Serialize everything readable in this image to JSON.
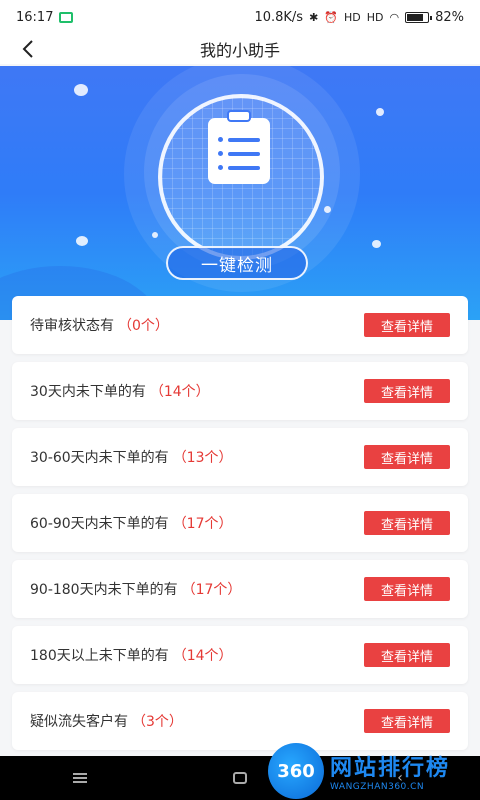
{
  "status_bar": {
    "time": "16:17",
    "network_speed": "10.8K/s",
    "signal_1": "HD",
    "signal_2": "HD",
    "battery": "82%",
    "battery_level": 0.82
  },
  "nav": {
    "title": "我的小助手",
    "back_icon": "chevron-left-icon"
  },
  "hero": {
    "icon": "clipboard-icon",
    "detect_button": "一键检测"
  },
  "items": [
    {
      "label": "待审核状态有",
      "count": "（0个）",
      "button": "查看详情"
    },
    {
      "label": "30天内未下单的有",
      "count": "（14个）",
      "button": "查看详情"
    },
    {
      "label": "30-60天内未下单的有",
      "count": "（13个）",
      "button": "查看详情"
    },
    {
      "label": "60-90天内未下单的有",
      "count": "（17个）",
      "button": "查看详情"
    },
    {
      "label": "90-180天内未下单的有",
      "count": "（17个）",
      "button": "查看详情"
    },
    {
      "label": "180天以上未下单的有",
      "count": "（14个）",
      "button": "查看详情"
    },
    {
      "label": "疑似流失客户有",
      "count": "（3个）",
      "button": "查看详情"
    }
  ],
  "watermark": {
    "logo": "360",
    "main": "网站排行榜",
    "sub": "WANGZHAN360.CN"
  },
  "colors": {
    "accent_blue": "#3f78f5",
    "detail_button": "#e94141",
    "count_red": "#e53935"
  }
}
